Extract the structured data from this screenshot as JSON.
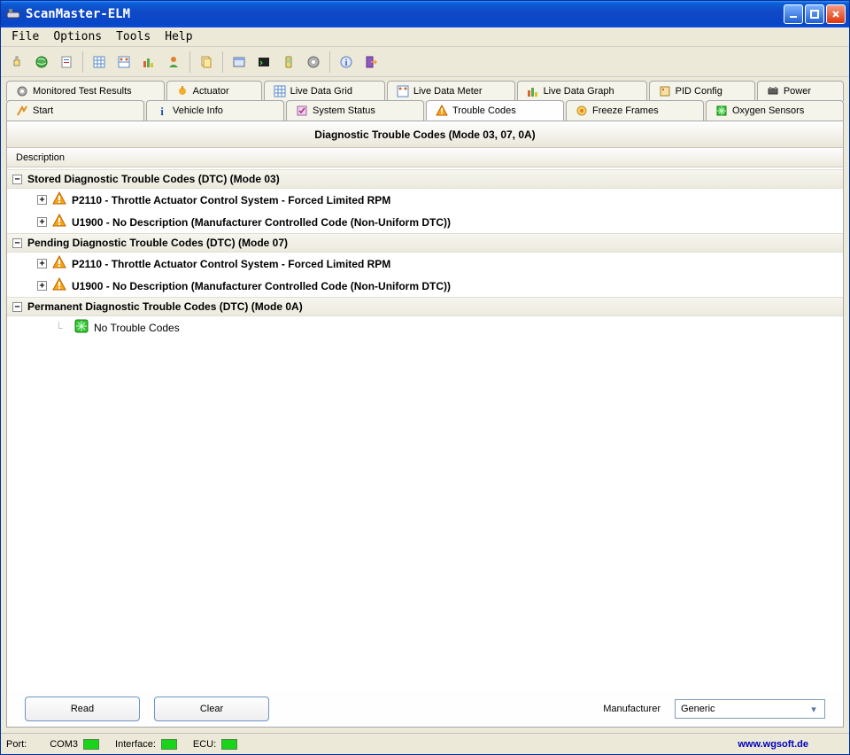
{
  "window": {
    "title": "ScanMaster-ELM"
  },
  "menu": {
    "file": "File",
    "options": "Options",
    "tools": "Tools",
    "help": "Help"
  },
  "tabs_top": [
    {
      "label": "Monitored Test Results"
    },
    {
      "label": "Actuator"
    },
    {
      "label": "Live Data Grid"
    },
    {
      "label": "Live Data Meter"
    },
    {
      "label": "Live Data Graph"
    },
    {
      "label": "PID Config"
    },
    {
      "label": "Power"
    }
  ],
  "tabs_bottom": [
    {
      "label": "Start"
    },
    {
      "label": "Vehicle Info"
    },
    {
      "label": "System Status"
    },
    {
      "label": "Trouble Codes"
    },
    {
      "label": "Freeze Frames"
    },
    {
      "label": "Oxygen Sensors"
    }
  ],
  "panel": {
    "title": "Diagnostic Trouble Codes (Mode 03, 07, 0A)",
    "column": "Description"
  },
  "tree": {
    "stored": {
      "label": "Stored Diagnostic Trouble Codes (DTC) (Mode 03)",
      "items": [
        "P2110 - Throttle Actuator Control System - Forced Limited RPM",
        "U1900 - No Description (Manufacturer Controlled Code (Non-Uniform DTC))"
      ]
    },
    "pending": {
      "label": "Pending Diagnostic Trouble Codes (DTC) (Mode 07)",
      "items": [
        "P2110 - Throttle Actuator Control System - Forced Limited RPM",
        "U1900 - No Description (Manufacturer Controlled Code (Non-Uniform DTC))"
      ]
    },
    "permanent": {
      "label": "Permanent Diagnostic Trouble Codes (DTC) (Mode 0A)",
      "empty": "No Trouble Codes"
    }
  },
  "buttons": {
    "read": "Read",
    "clear": "Clear"
  },
  "manufacturer": {
    "label": "Manufacturer",
    "value": "Generic"
  },
  "status": {
    "port_label": "Port:",
    "port_value": "COM3",
    "interface_label": "Interface:",
    "ecu_label": "ECU:",
    "link": "www.wgsoft.de"
  }
}
